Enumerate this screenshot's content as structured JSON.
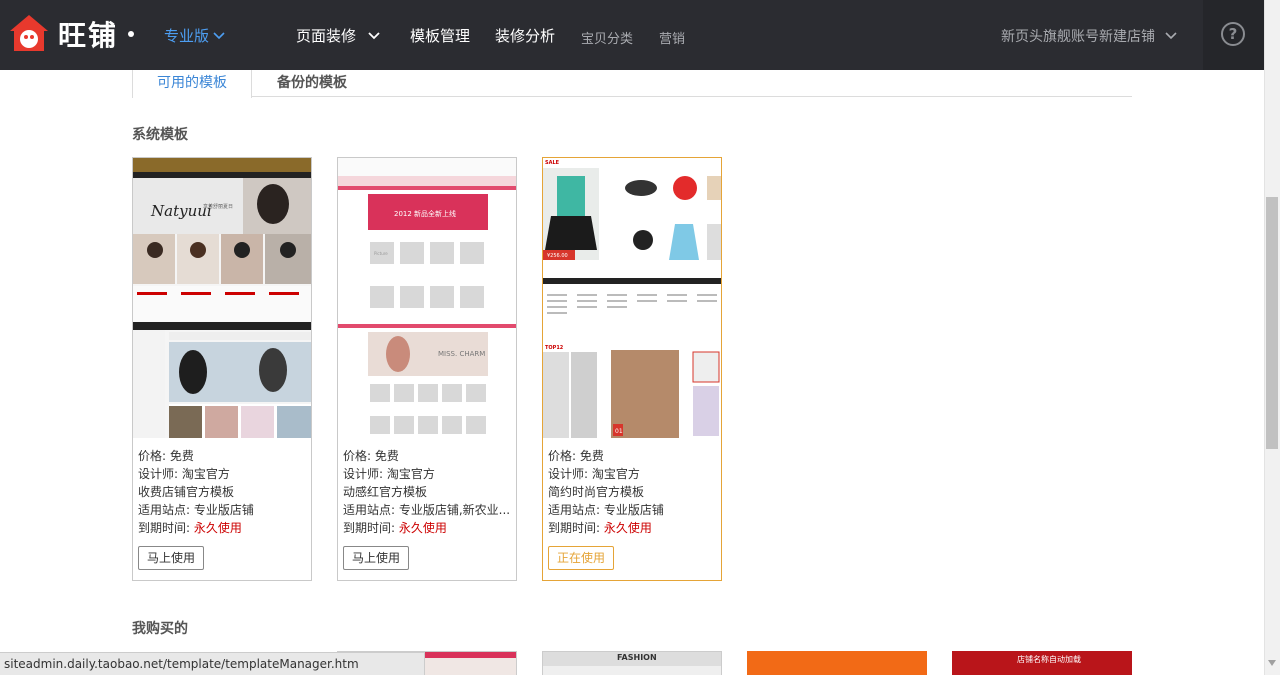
{
  "header": {
    "logo_text": "旺铺",
    "edition": "专业版",
    "nav": [
      "页面装修",
      "模板管理",
      "装修分析",
      "宝贝分类",
      "营销"
    ],
    "shop_name": "新页头旗舰账号新建店铺",
    "help_glyph": "?"
  },
  "tabs": [
    {
      "label": "可用的模板",
      "active": true
    },
    {
      "label": "备份的模板",
      "active": false
    }
  ],
  "sections": {
    "system": "系统模板",
    "bought": "我购买的"
  },
  "templates": [
    {
      "price_label": "价格: ",
      "price": "免费",
      "designer_label": "设计师: ",
      "designer": "淘宝官方",
      "name": "收费店铺官方模板",
      "site_label": "适用站点: ",
      "site": "专业版店铺",
      "expire_label": "到期时间: ",
      "expire": "永久使用",
      "button": "马上使用",
      "in_use": false,
      "thumb": {
        "brand": "Natyuui",
        "banner_text": "享着舒丽夏日"
      }
    },
    {
      "price_label": "价格: ",
      "price": "免费",
      "designer_label": "设计师: ",
      "designer": "淘宝官方",
      "name": "动感红官方模板",
      "site_label": "适用站点: ",
      "site": "专业版店铺,新农业...",
      "expire_label": "到期时间: ",
      "expire": "永久使用",
      "button": "马上使用",
      "in_use": false,
      "thumb": {
        "banner_text": "2012 新品全新上线",
        "brand": "MISS. CHARM",
        "tile_text": "Picture"
      }
    },
    {
      "price_label": "价格: ",
      "price": "免费",
      "designer_label": "设计师: ",
      "designer": "淘宝官方",
      "name": "简约时尚官方模板",
      "site_label": "适用站点: ",
      "site": "专业版店铺",
      "expire_label": "到期时间: ",
      "expire": "永久使用",
      "button": "正在使用",
      "in_use": true,
      "thumb": {
        "sale": "SALE",
        "price_tag": "¥256.00",
        "top": "TOP12",
        "rank": "01"
      }
    }
  ],
  "bought_thumbs": [
    {
      "label": ""
    },
    {
      "label": "FASHION"
    },
    {
      "label": ""
    },
    {
      "label": "店铺名称自动加载"
    }
  ],
  "statusbar": "siteadmin.daily.taobao.net/template/templateManager.htm",
  "colors": {
    "topbar": "#2b2c31",
    "accent_blue": "#3b86d6",
    "in_use": "#e5a437",
    "expire_red": "#cc0000"
  }
}
